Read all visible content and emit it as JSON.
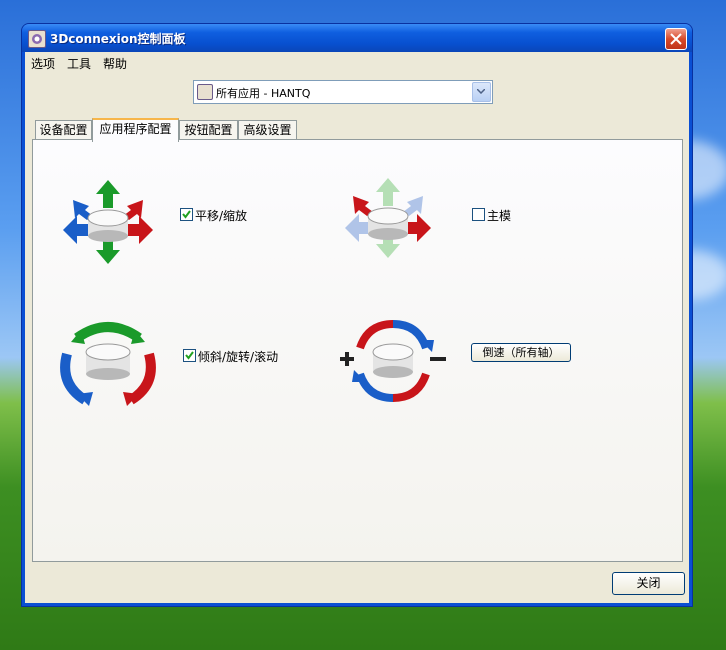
{
  "window": {
    "title": "3Dconnexion控制面板"
  },
  "menu": {
    "items": [
      "选项",
      "工具",
      "帮助"
    ]
  },
  "app_selector": {
    "value": "所有应用 - HANTQ"
  },
  "tabs": [
    "设备配置",
    "应用程序配置",
    "按钮配置",
    "高级设置"
  ],
  "active_tab": "应用程序配置",
  "controls": {
    "pan_zoom": {
      "label": "平移/缩放",
      "checked": true
    },
    "dominant": {
      "label": "主模",
      "checked": false
    },
    "tilt_spin_roll": {
      "label": "倾斜/旋转/滚动",
      "checked": true
    },
    "speed_button": {
      "label": "倒速（所有轴）"
    }
  },
  "footer": {
    "close_label": "关闭"
  },
  "colors": {
    "tab_highlight": "#f7b64a",
    "titlebar": "#0850d0"
  }
}
